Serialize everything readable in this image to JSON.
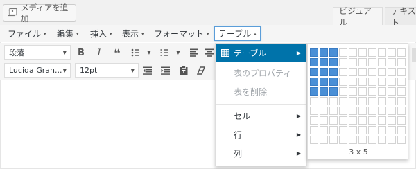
{
  "media_button": {
    "label": "メディアを追加"
  },
  "tabs": {
    "visual": "ビジュアル",
    "text": "テキスト"
  },
  "menubar": [
    {
      "label": "ファイル",
      "caret": "▾"
    },
    {
      "label": "編集",
      "caret": "▾"
    },
    {
      "label": "挿入",
      "caret": "▾"
    },
    {
      "label": "表示",
      "caret": "▾"
    },
    {
      "label": "フォーマット",
      "caret": "▾"
    },
    {
      "label": "テーブル",
      "caret": "▴"
    }
  ],
  "toolbar": {
    "format_select": "段落",
    "font_select": "Lucida Gran...",
    "size_select": "12pt"
  },
  "table_menu": {
    "items": [
      {
        "label": "テーブル",
        "selected": true,
        "submenu": true,
        "icon": "table-grid-icon"
      },
      {
        "label": "表のプロパティ",
        "disabled": true
      },
      {
        "label": "表を削除",
        "disabled": true
      },
      {
        "label": "セル",
        "submenu": true
      },
      {
        "label": "行",
        "submenu": true
      },
      {
        "label": "列",
        "submenu": true
      }
    ]
  },
  "grid_picker": {
    "columns": 10,
    "rows": 10,
    "selected_cols": 3,
    "selected_rows": 5,
    "label": "3 x 5"
  },
  "colors": {
    "accent": "#0073aa",
    "grid_on": "#4a8fd6"
  }
}
